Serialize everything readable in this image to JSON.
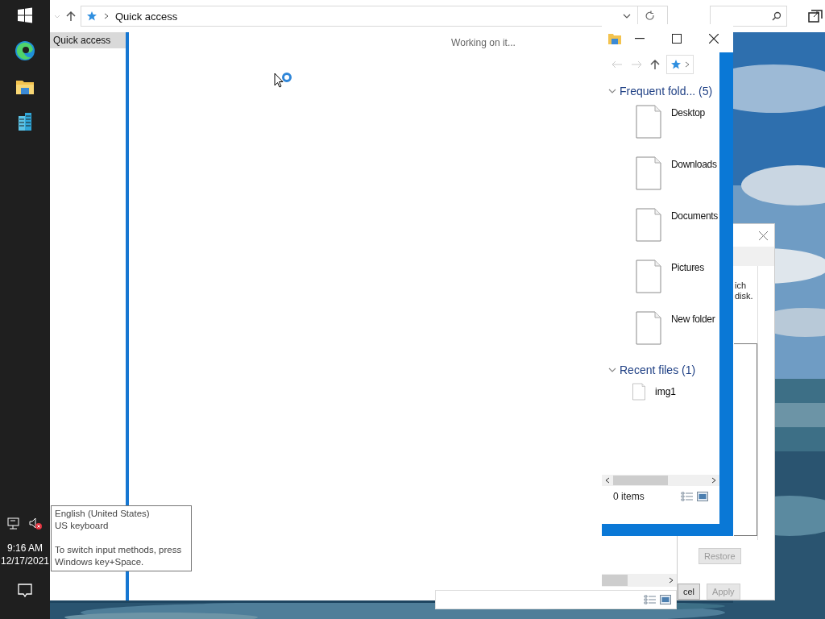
{
  "taskbar": {
    "time": "9:16 AM",
    "date": "12/17/2021"
  },
  "main_window": {
    "address": "Quick access",
    "nav_items": [
      {
        "label": "Quick access",
        "selected": true
      }
    ],
    "status_text": "Working on it..."
  },
  "side_window": {
    "groups": [
      {
        "title": "Frequent fold... (5)",
        "expanded": true,
        "kind": "tiles",
        "items": [
          "Desktop",
          "Downloads",
          "Documents",
          "Pictures",
          "New folder"
        ]
      },
      {
        "title": "Recent files (1)",
        "expanded": true,
        "kind": "list",
        "items": [
          "img1"
        ]
      }
    ],
    "item_count": "0 items"
  },
  "dialog": {
    "text_fragments": [
      "ich",
      "disk."
    ],
    "buttons": [
      {
        "label": "Restore",
        "disabled": true
      },
      {
        "label": "cel",
        "disabled": false
      },
      {
        "label": "Apply",
        "disabled": true
      }
    ]
  },
  "tooltip": {
    "lines": [
      "English (United States)",
      "US keyboard"
    ],
    "hint": "To switch input methods, press Windows key+Space."
  }
}
